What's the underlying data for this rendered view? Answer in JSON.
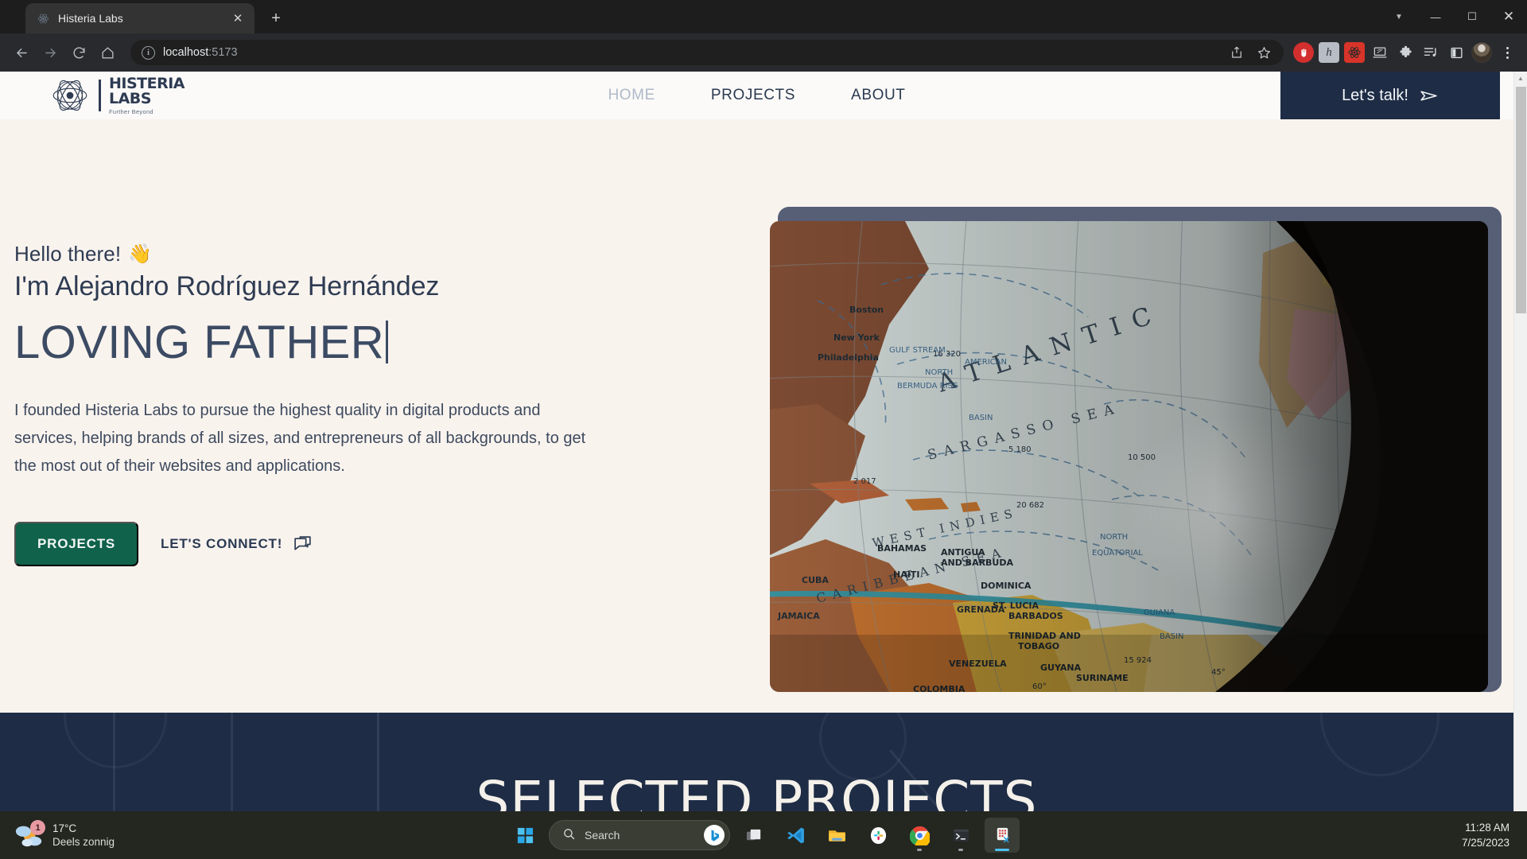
{
  "browser": {
    "tab": {
      "title": "Histeria Labs",
      "favicon_icon": "atom-favicon",
      "close_icon": "close-icon"
    },
    "new_tab_icon": "plus-icon",
    "window_controls": {
      "expand_icon": "chevron-down-icon",
      "minimize_icon": "minimize-icon",
      "maximize_icon": "maximize-icon",
      "close_icon": "close-icon"
    },
    "nav": {
      "back_icon": "back-arrow-icon",
      "forward_icon": "forward-arrow-icon",
      "reload_icon": "reload-icon",
      "home_icon": "home-icon"
    },
    "omnibox": {
      "info_icon": "info-circle-icon",
      "url_host": "localhost",
      "url_port": ":5173",
      "share_icon": "share-icon",
      "bookmark_icon": "star-icon"
    },
    "extensions": [
      {
        "name": "adblock-stop-icon",
        "glyph": "✋"
      },
      {
        "name": "hypothesis-icon",
        "glyph": "h"
      },
      {
        "name": "react-devtools-icon",
        "glyph": "⚛"
      },
      {
        "name": "responsive-viewer-icon",
        "glyph": "ὋB"
      },
      {
        "name": "extensions-puzzle-icon",
        "glyph": "❖"
      },
      {
        "name": "reading-list-icon",
        "glyph": "♫"
      }
    ],
    "side_panel_icon": "side-panel-icon",
    "profile_avatar": "avatar",
    "menu_icon": "kebab-menu-icon",
    "scrollbar": {
      "up_arrow_icon": "scroll-up-arrow-icon"
    }
  },
  "site": {
    "logo": {
      "mark_icon": "atom-logo-icon",
      "line1": "HISTERIA",
      "line2": "LABS",
      "tagline": "Further Beyond"
    },
    "nav_links": [
      {
        "label": "HOME",
        "active": true
      },
      {
        "label": "PROJECTS",
        "active": false
      },
      {
        "label": "ABOUT",
        "active": false
      }
    ],
    "cta": {
      "label": "Let's talk!",
      "icon": "send-paper-plane-icon"
    },
    "hero": {
      "greeting": "Hello there!",
      "wave_emoji": "👋",
      "name_line": "I'm Alejandro Rodríguez Hernández",
      "role_typed": "LOVING FATHER",
      "blurb": "I founded Histeria Labs to pursue the highest quality in digital products and services, helping brands of all sizes, and entrepreneurs of all backgrounds, to get the most out of their websites and applications.",
      "primary_button": "PROJECTS",
      "secondary_button": "LET'S CONNECT!",
      "secondary_icon": "chat-bubble-icon",
      "image_alt": "vintage-globe-atlantic"
    },
    "projects_section": {
      "title": "SELECTED PROJECTS"
    },
    "colors": {
      "page_bg": "#f9f3ee",
      "navy": "#1e2c45",
      "green": "#10624a",
      "text": "#2e3b52",
      "muted_nav": "#aebac9",
      "frame": "#575f76"
    }
  },
  "taskbar": {
    "weather": {
      "temperature": "17°C",
      "condition": "Deels zonnig",
      "badge": "1",
      "icon": "weather-partly-sunny-icon"
    },
    "start_icon": "windows-start-icon",
    "search": {
      "placeholder": "Search",
      "icon": "search-icon",
      "assistant_icon": "bing-chat-icon"
    },
    "apps": [
      {
        "name": "task-view-icon"
      },
      {
        "name": "vs-code-icon"
      },
      {
        "name": "file-explorer-icon"
      },
      {
        "name": "slack-icon"
      },
      {
        "name": "google-chrome-icon",
        "running": true
      },
      {
        "name": "windows-terminal-icon",
        "running": true
      },
      {
        "name": "snipping-tool-icon",
        "active": true
      }
    ],
    "clock": {
      "time": "11:28 AM",
      "date": "7/25/2023"
    }
  }
}
